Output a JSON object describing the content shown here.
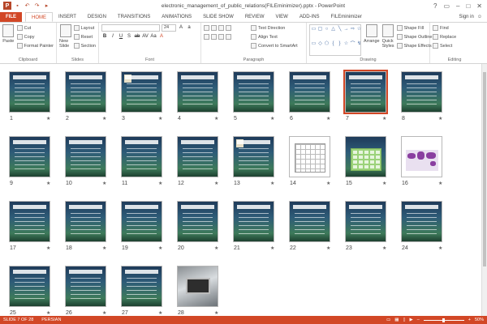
{
  "window": {
    "title": "electronic_management_of_public_relations(FILEminimizer).pptx - PowerPoint",
    "app_logo": "P",
    "controls": [
      "?",
      "▭",
      "–",
      "□",
      "✕"
    ]
  },
  "ribbon_tabs": {
    "file": "FILE",
    "items": [
      "HOME",
      "INSERT",
      "DESIGN",
      "TRANSITIONS",
      "ANIMATIONS",
      "SLIDE SHOW",
      "REVIEW",
      "VIEW",
      "ADD-INS",
      "FILEminimizer"
    ],
    "active": "HOME",
    "sign_in": "Sign in"
  },
  "clipboard": {
    "paste": "Paste",
    "cut": "Cut",
    "copy": "Copy",
    "format_painter": "Format Painter",
    "label": "Clipboard"
  },
  "slides_group": {
    "new_slide": "New Slide",
    "layout": "Layout",
    "reset": "Reset",
    "section": "Section",
    "label": "Slides"
  },
  "font_group": {
    "font_name": "",
    "font_size": "24",
    "label": "Font",
    "buttons": [
      "B",
      "I",
      "U",
      "S",
      "ab",
      "AV",
      "Aa",
      "A"
    ]
  },
  "paragraph_group": {
    "text_direction": "Text Direction",
    "align_text": "Align Text",
    "convert_smartart": "Convert to SmartArt",
    "label": "Paragraph"
  },
  "drawing_group": {
    "arrange": "Arrange",
    "quick_styles": "Quick Styles",
    "shape_fill": "Shape Fill",
    "shape_outline": "Shape Outline",
    "shape_effects": "Shape Effects",
    "label": "Drawing",
    "shapes": [
      "▭",
      "▢",
      "○",
      "△",
      "╲",
      "→",
      "⇨",
      "☆",
      "▭",
      "◇",
      "⬠",
      "{",
      "}",
      "☆",
      "⌒",
      "↯"
    ]
  },
  "editing_group": {
    "find": "Find",
    "replace": "Replace",
    "select": "Select",
    "label": "Editing"
  },
  "slides": [
    {
      "n": "1"
    },
    {
      "n": "2"
    },
    {
      "n": "3"
    },
    {
      "n": "4"
    },
    {
      "n": "5"
    },
    {
      "n": "6"
    },
    {
      "n": "7"
    },
    {
      "n": "8"
    },
    {
      "n": "9"
    },
    {
      "n": "10"
    },
    {
      "n": "11"
    },
    {
      "n": "12"
    },
    {
      "n": "13"
    },
    {
      "n": "14"
    },
    {
      "n": "15"
    },
    {
      "n": "16"
    },
    {
      "n": "17"
    },
    {
      "n": "18"
    },
    {
      "n": "19"
    },
    {
      "n": "20"
    },
    {
      "n": "21"
    },
    {
      "n": "22"
    },
    {
      "n": "23"
    },
    {
      "n": "24"
    },
    {
      "n": "25"
    },
    {
      "n": "26"
    },
    {
      "n": "27"
    },
    {
      "n": "28"
    }
  ],
  "selected_slide": 7,
  "star": "★",
  "status": {
    "slide_info": "SLIDE 7 OF 28",
    "language": "PERSIAN",
    "zoom": "50%",
    "minus": "–",
    "plus": "+"
  },
  "colors": {
    "accent": "#d24726",
    "selection": "#d24726"
  }
}
